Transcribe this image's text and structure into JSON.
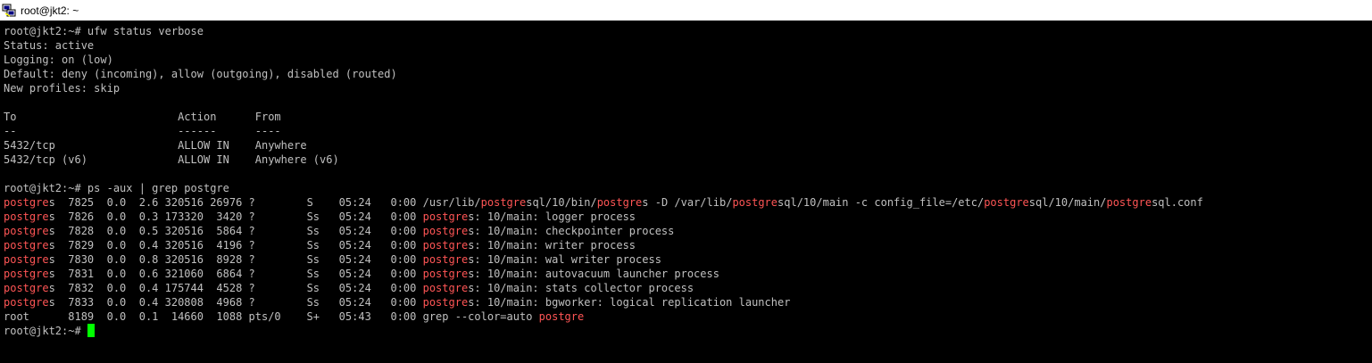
{
  "window": {
    "title": "root@jkt2: ~",
    "icon": "putty-icon"
  },
  "colors": {
    "background": "#000000",
    "text": "#c0c0c0",
    "highlight": "#ff5555",
    "cursor": "#00ff00",
    "titlebar": "#ffffff"
  },
  "terminal": {
    "lines": [
      [
        {
          "t": "root@jkt2:~# ufw status verbose"
        }
      ],
      [
        {
          "t": "Status: active"
        }
      ],
      [
        {
          "t": "Logging: on (low)"
        }
      ],
      [
        {
          "t": "Default: deny (incoming), allow (outgoing), disabled (routed)"
        }
      ],
      [
        {
          "t": "New profiles: skip"
        }
      ],
      [
        {
          "t": ""
        }
      ],
      [
        {
          "t": "To                         Action      From"
        }
      ],
      [
        {
          "t": "--                         ------      ----"
        }
      ],
      [
        {
          "t": "5432/tcp                   ALLOW IN    Anywhere"
        }
      ],
      [
        {
          "t": "5432/tcp (v6)              ALLOW IN    Anywhere (v6)"
        }
      ],
      [
        {
          "t": ""
        }
      ],
      [
        {
          "t": "root@jkt2:~# ps -aux | grep postgre"
        }
      ],
      [
        {
          "t": "postgre",
          "hl": true
        },
        {
          "t": "s  7825  0.0  2.6 320516 26976 ?        S    05:24   0:00 /usr/lib/"
        },
        {
          "t": "postgre",
          "hl": true
        },
        {
          "t": "sql/10/bin/"
        },
        {
          "t": "postgre",
          "hl": true
        },
        {
          "t": "s -D /var/lib/"
        },
        {
          "t": "postgre",
          "hl": true
        },
        {
          "t": "sql/10/main -c config_file=/etc/"
        },
        {
          "t": "postgre",
          "hl": true
        },
        {
          "t": "sql/10/main/"
        },
        {
          "t": "postgre",
          "hl": true
        },
        {
          "t": "sql.conf"
        }
      ],
      [
        {
          "t": "postgre",
          "hl": true
        },
        {
          "t": "s  7826  0.0  0.3 173320  3420 ?        Ss   05:24   0:00 "
        },
        {
          "t": "postgre",
          "hl": true
        },
        {
          "t": "s: 10/main: logger process"
        }
      ],
      [
        {
          "t": "postgre",
          "hl": true
        },
        {
          "t": "s  7828  0.0  0.5 320516  5864 ?        Ss   05:24   0:00 "
        },
        {
          "t": "postgre",
          "hl": true
        },
        {
          "t": "s: 10/main: checkpointer process"
        }
      ],
      [
        {
          "t": "postgre",
          "hl": true
        },
        {
          "t": "s  7829  0.0  0.4 320516  4196 ?        Ss   05:24   0:00 "
        },
        {
          "t": "postgre",
          "hl": true
        },
        {
          "t": "s: 10/main: writer process"
        }
      ],
      [
        {
          "t": "postgre",
          "hl": true
        },
        {
          "t": "s  7830  0.0  0.8 320516  8928 ?        Ss   05:24   0:00 "
        },
        {
          "t": "postgre",
          "hl": true
        },
        {
          "t": "s: 10/main: wal writer process"
        }
      ],
      [
        {
          "t": "postgre",
          "hl": true
        },
        {
          "t": "s  7831  0.0  0.6 321060  6864 ?        Ss   05:24   0:00 "
        },
        {
          "t": "postgre",
          "hl": true
        },
        {
          "t": "s: 10/main: autovacuum launcher process"
        }
      ],
      [
        {
          "t": "postgre",
          "hl": true
        },
        {
          "t": "s  7832  0.0  0.4 175744  4528 ?        Ss   05:24   0:00 "
        },
        {
          "t": "postgre",
          "hl": true
        },
        {
          "t": "s: 10/main: stats collector process"
        }
      ],
      [
        {
          "t": "postgre",
          "hl": true
        },
        {
          "t": "s  7833  0.0  0.4 320808  4968 ?        Ss   05:24   0:00 "
        },
        {
          "t": "postgre",
          "hl": true
        },
        {
          "t": "s: 10/main: bgworker: logical replication launcher"
        }
      ],
      [
        {
          "t": "root      8189  0.0  0.1  14660  1088 pts/0    S+   05:43   0:00 grep --color=auto "
        },
        {
          "t": "postgre",
          "hl": true
        }
      ],
      [
        {
          "t": "root@jkt2:~# "
        },
        {
          "cursor": true
        }
      ]
    ]
  }
}
